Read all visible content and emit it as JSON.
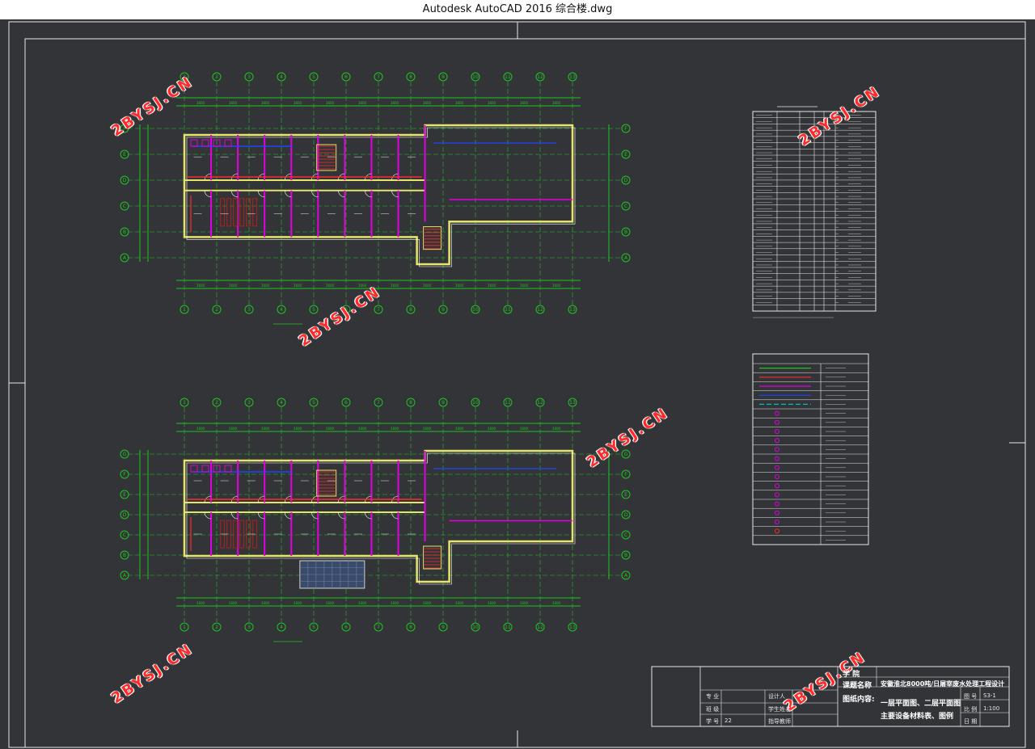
{
  "window": {
    "title": "Autodesk AutoCAD 2016    综合楼.dwg"
  },
  "colors": {
    "background": "#323438",
    "grid": "#22c322",
    "wall": "#e5e56a",
    "pipe_red": "#ff2a2a",
    "pipe_blue": "#2244ff",
    "magenta": "#e000e0",
    "frame": "#ffffff",
    "watermark": "#ff2a2a"
  },
  "watermarks": [
    "2BYSJ.CN",
    "2BYSJ.CN",
    "2BYSJ.CN",
    "2BYSJ.CN",
    "2BYSJ.CN",
    "2BYSJ.CN"
  ],
  "plans": {
    "floor1": {
      "axis_labels_top": [
        "1",
        "2",
        "3",
        "4",
        "5",
        "6",
        "7",
        "8",
        "9",
        "10",
        "11",
        "12",
        "13"
      ],
      "axis_labels_side": [
        "F",
        "E",
        "D",
        "C",
        "B",
        "A"
      ]
    },
    "floor2": {
      "axis_labels_top": [
        "1",
        "2",
        "3",
        "4",
        "5",
        "6",
        "7",
        "8",
        "9",
        "10",
        "11",
        "12",
        "13"
      ],
      "axis_labels_side": [
        "G",
        "F",
        "E",
        "D",
        "C",
        "B",
        "A"
      ]
    }
  },
  "title_block": {
    "school_label": "学  院",
    "project_label": "课题名称",
    "project_name": "安徽淮北8000吨/日屠宰废水处理工程设计",
    "content_label": "图纸内容:",
    "content_line1": "一层平面图、二层平面图",
    "content_line2": "主要设备材料表、图例",
    "drawing_no_label": "图 号",
    "drawing_no": "S3-1",
    "scale_label": "比 例",
    "scale": "1:100",
    "date_label": "日 期",
    "major_label": "专 业",
    "class_label": "班 级",
    "student_no_label": "学 号",
    "student_no": "22",
    "designer_label": "设计人",
    "student_name_label": "学生姓名",
    "advisor_label": "指导教师"
  }
}
